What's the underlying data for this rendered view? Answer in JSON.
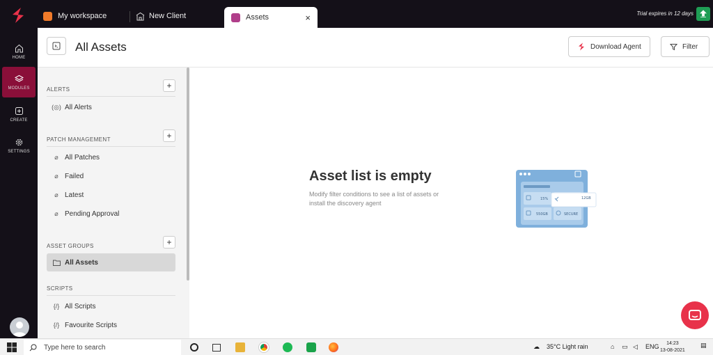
{
  "tabs": {
    "workspace": "My workspace",
    "client": "New Client",
    "assets": "Assets",
    "close": "×"
  },
  "trial": "Trial expires in 12 days",
  "rail": {
    "home": "HOME",
    "modules": "MODULES",
    "create": "CREATE",
    "settings": "SETTINGS"
  },
  "header": {
    "title": "All Assets",
    "download_label": "Download Agent",
    "filter_label": "Filter"
  },
  "panel": {
    "alerts": {
      "title": "ALERTS",
      "items": [
        "All Alerts"
      ]
    },
    "patch": {
      "title": "PATCH MANAGEMENT",
      "items": [
        "All Patches",
        "Failed",
        "Latest",
        "Pending Approval"
      ]
    },
    "groups": {
      "title": "ASSET GROUPS",
      "items": [
        "All Assets"
      ]
    },
    "scripts": {
      "title": "SCRIPTS",
      "items": [
        "All Scripts",
        "Favourite Scripts"
      ]
    },
    "plus": "+"
  },
  "main": {
    "empty_title": "Asset list is empty",
    "empty_desc": "Modify filter conditions to see a list of assets or install the discovery agent",
    "illustration": {
      "stat1": "15%",
      "stat2": "550GB",
      "stat3": "SECURE",
      "card": "12GB"
    }
  },
  "taskbar": {
    "search_placeholder": "Type here to search",
    "weather": "35°C  Light rain",
    "lang": "ENG",
    "time": "14:23",
    "date": "13-08-2021"
  },
  "colors": {
    "brand": "#e8324a",
    "active_module": "#8a0f39",
    "topbar": "#141018"
  }
}
